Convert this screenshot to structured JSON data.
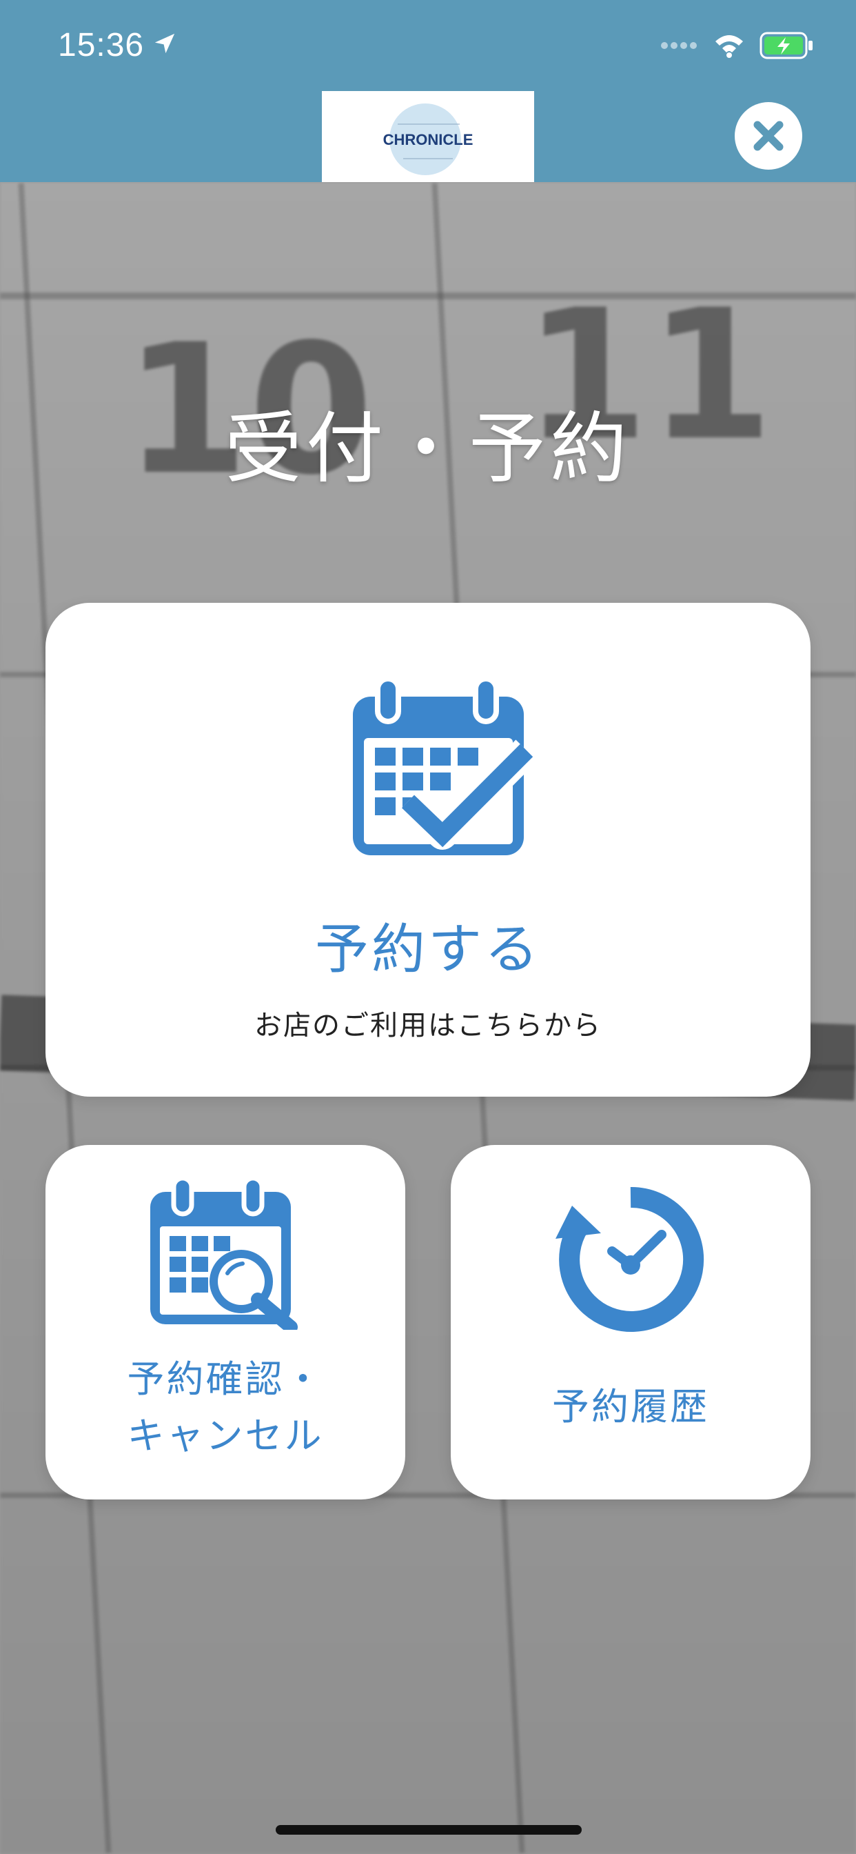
{
  "status_bar": {
    "time": "15:36"
  },
  "header": {
    "logo_text": "CHRONICLE",
    "close_icon": "close-icon"
  },
  "page": {
    "title": "受付・予約"
  },
  "cards": {
    "reserve": {
      "title": "予約する",
      "subtitle": "お店のご利用はこちらから",
      "icon": "calendar-check-icon"
    },
    "confirm": {
      "line1": "予約確認・",
      "line2": "キャンセル",
      "icon": "calendar-search-icon"
    },
    "history": {
      "label": "予約履歴",
      "icon": "history-clock-icon"
    }
  },
  "colors": {
    "header_bg": "#5b9ab8",
    "accent_blue": "#3c86cc",
    "card_bg": "#ffffff"
  }
}
